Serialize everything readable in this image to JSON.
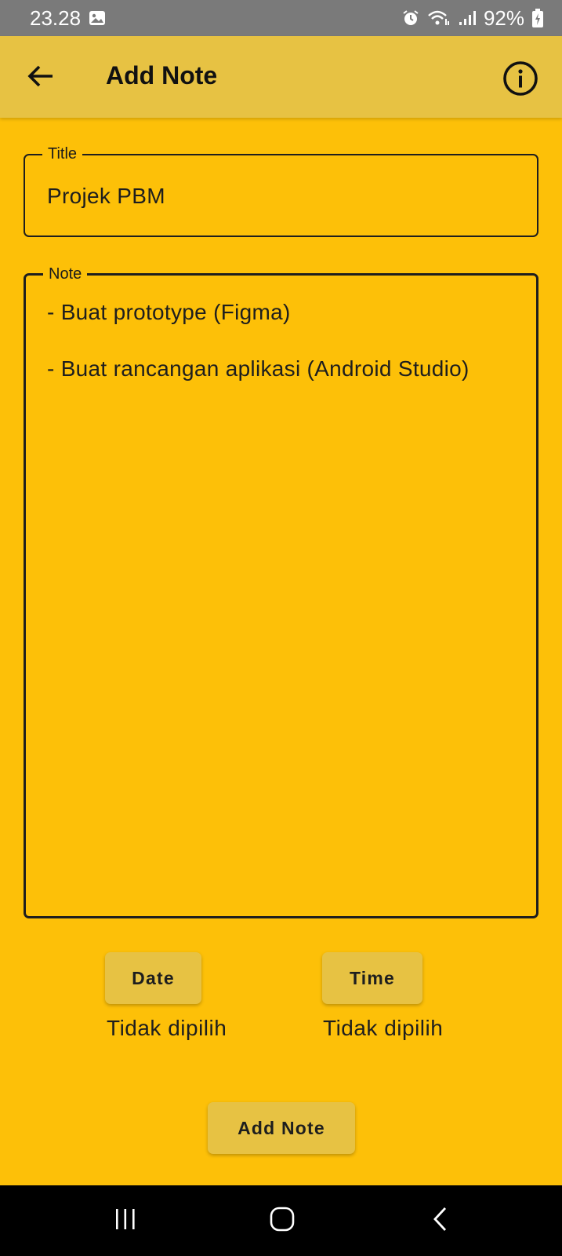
{
  "status_bar": {
    "time": "23.28",
    "battery": "92%",
    "icons": [
      "image-icon",
      "alarm-icon",
      "wifi-icon",
      "signal-icon",
      "battery-charging-icon"
    ]
  },
  "app_bar": {
    "title": "Add Note",
    "back_icon": "arrow-left-icon",
    "info_icon": "info-icon"
  },
  "form": {
    "title_field": {
      "label": "Title",
      "value": "Projek PBM"
    },
    "note_field": {
      "label": "Note",
      "lines": [
        "- Buat prototype (Figma)",
        "- Buat rancangan aplikasi (Android Studio)"
      ]
    },
    "date": {
      "button_label": "Date",
      "selected": "Tidak dipilih"
    },
    "time": {
      "button_label": "Time",
      "selected": "Tidak dipilih"
    },
    "submit_label": "Add Note"
  },
  "nav_bar": {
    "icons": [
      "recents-icon",
      "home-icon",
      "back-icon"
    ]
  },
  "colors": {
    "background": "#FDC008",
    "app_bar": "#E7C243",
    "button": "#E7C243",
    "status_bar": "#7a7a7a"
  }
}
